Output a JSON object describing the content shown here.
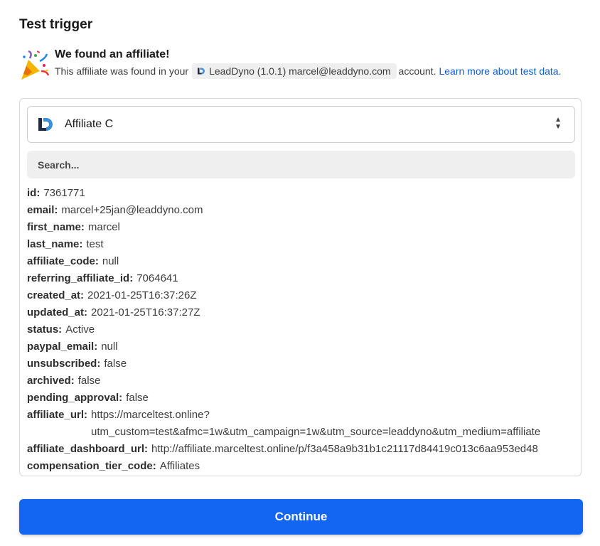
{
  "page": {
    "title": "Test trigger"
  },
  "result": {
    "heading": "We found an affiliate!",
    "line_prefix": "This affiliate was found in your",
    "account_label": "LeadDyno (1.0.1) marcel@leaddyno.com",
    "line_suffix": "account.",
    "learn_more": "Learn more about test data."
  },
  "record_select": {
    "selected": "Affiliate C"
  },
  "search": {
    "placeholder": "Search..."
  },
  "fields": [
    {
      "key": "id:",
      "value": "7361771"
    },
    {
      "key": "email:",
      "value": "marcel+25jan@leaddyno.com"
    },
    {
      "key": "first_name:",
      "value": "marcel"
    },
    {
      "key": "last_name:",
      "value": "test"
    },
    {
      "key": "affiliate_code:",
      "value": "null"
    },
    {
      "key": "referring_affiliate_id:",
      "value": "7064641"
    },
    {
      "key": "created_at:",
      "value": "2021-01-25T16:37:26Z"
    },
    {
      "key": "updated_at:",
      "value": "2021-01-25T16:37:27Z"
    },
    {
      "key": "status:",
      "value": "Active"
    },
    {
      "key": "paypal_email:",
      "value": "null"
    },
    {
      "key": "unsubscribed:",
      "value": "false"
    },
    {
      "key": "archived:",
      "value": "false"
    },
    {
      "key": "pending_approval:",
      "value": "false"
    },
    {
      "key": "affiliate_url:",
      "value": "https://marceltest.online?\nutm_custom=test&afmc=1w&utm_campaign=1w&utm_source=leaddyno&utm_medium=affiliate"
    },
    {
      "key": "affiliate_dashboard_url:",
      "value": "http://affiliate.marceltest.online/p/f3a458a9b31b1c21117d84419c013c6aa953ed48"
    },
    {
      "key": "compensation_tier_code:",
      "value": "Affiliates"
    }
  ],
  "actions": {
    "continue_label": "Continue"
  },
  "colors": {
    "primary": "#1266f1",
    "link": "#0b5bd3",
    "chip_bg": "#efefef"
  },
  "icons": {
    "celebration": "party-popper-icon",
    "app": "leaddyno-logo-icon",
    "select": "up-down-arrows-icon"
  }
}
